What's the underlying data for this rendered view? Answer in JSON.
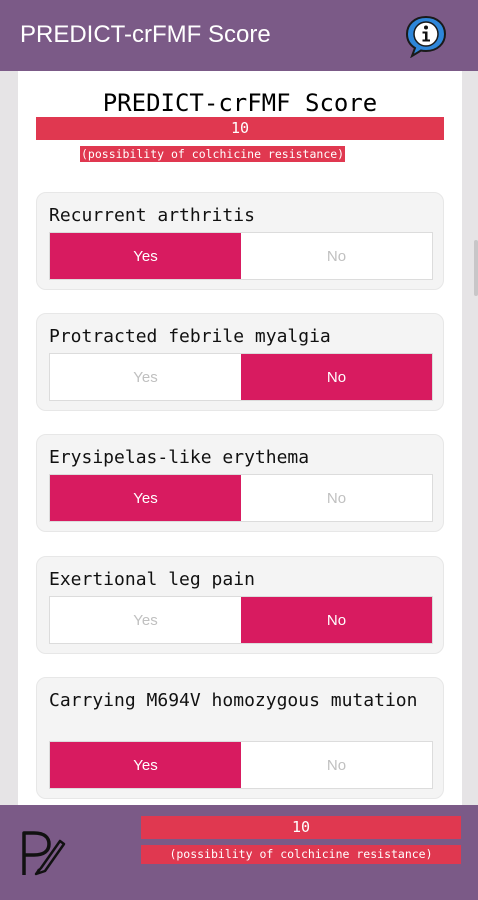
{
  "app": {
    "title": "PREDICT-crFMF Score",
    "info_icon": "info-icon",
    "bar_color": "#7b5a87"
  },
  "score": {
    "title": "PREDICT-crFMF Score",
    "value": "10",
    "caption": "(possibility of colchicine resistance)",
    "bar_color": "#e03850"
  },
  "questions": [
    {
      "label": "Recurrent arthritis",
      "yes": "Yes",
      "no": "No",
      "selected": "Yes"
    },
    {
      "label": "Protracted febrile myalgia",
      "yes": "Yes",
      "no": "No",
      "selected": "No"
    },
    {
      "label": "Erysipelas-like erythema",
      "yes": "Yes",
      "no": "No",
      "selected": "Yes"
    },
    {
      "label": "Exertional leg pain",
      "yes": "Yes",
      "no": "No",
      "selected": "No"
    },
    {
      "label": "Carrying M694V homozygous mutation",
      "yes": "Yes",
      "no": "No",
      "selected": "Yes"
    }
  ],
  "toggle_active_color": "#d81b60",
  "footer": {
    "logo_icon": "p-pen-logo-icon",
    "value": "10",
    "caption": "(possibility of colchicine resistance)"
  }
}
